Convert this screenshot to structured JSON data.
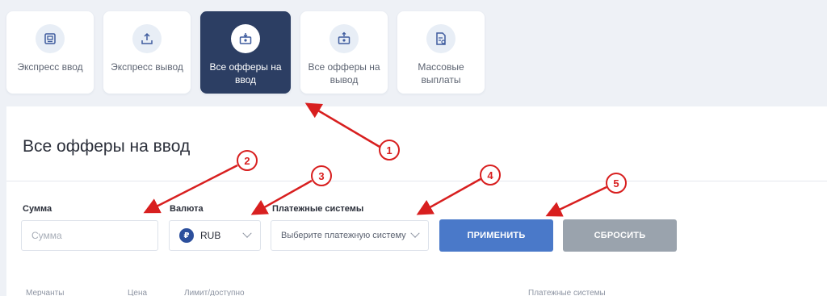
{
  "tabs": [
    {
      "label": "Экспресс ввод",
      "icon": "deposit-icon",
      "active": false
    },
    {
      "label": "Экспресс вывод",
      "icon": "withdraw-icon",
      "active": false
    },
    {
      "label": "Все офферы на ввод",
      "icon": "offers-in-icon",
      "active": true
    },
    {
      "label": "Все офферы на вывод",
      "icon": "offers-out-icon",
      "active": false
    },
    {
      "label": "Массовые выплаты",
      "icon": "mass-payout-icon",
      "active": false
    }
  ],
  "page": {
    "title": "Все офферы на ввод"
  },
  "filters": {
    "amount_label": "Сумма",
    "amount_placeholder": "Сумма",
    "currency_label": "Валюта",
    "currency_value": "RUB",
    "currency_symbol": "₽",
    "payment_label": "Платежные системы",
    "payment_placeholder": "Выберите платежную систему"
  },
  "buttons": {
    "apply": "ПРИМЕНИТЬ",
    "reset": "СБРОСИТЬ"
  },
  "table": {
    "headers": [
      "Мерчанты",
      "Цена",
      "Лимит/доступно",
      "Платежные системы"
    ]
  },
  "annotations": [
    "1",
    "2",
    "3",
    "4",
    "5"
  ],
  "colors": {
    "accent": "#4a79c9",
    "active_tab": "#2c3e63",
    "annotation": "#d81f1f",
    "reset": "#9aa3ad"
  }
}
